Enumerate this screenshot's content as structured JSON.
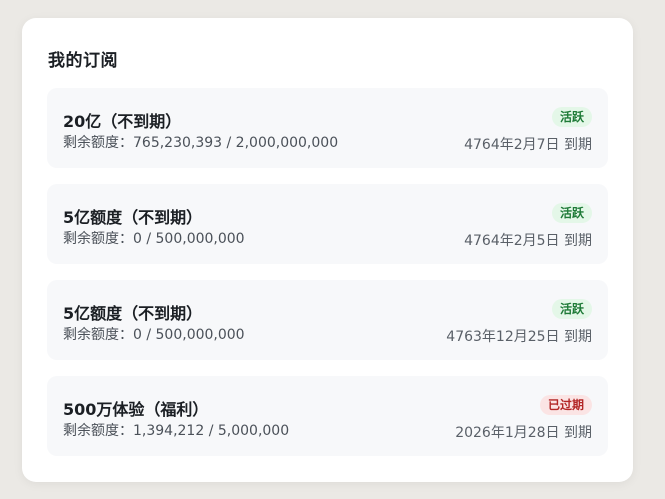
{
  "title": "我的订阅",
  "subscriptions": [
    {
      "name": "20亿（不到期）",
      "quota": "剩余额度：765,230,393 / 2,000,000,000",
      "status": "活跃",
      "status_type": "active",
      "expiry": "4764年2月7日 到期"
    },
    {
      "name": "5亿额度（不到期）",
      "quota": "剩余额度：0 / 500,000,000",
      "status": "活跃",
      "status_type": "active",
      "expiry": "4764年2月5日 到期"
    },
    {
      "name": "5亿额度（不到期）",
      "quota": "剩余额度：0 / 500,000,000",
      "status": "活跃",
      "status_type": "active",
      "expiry": "4763年12月25日 到期"
    },
    {
      "name": "500万体验（福利）",
      "quota": "剩余额度：1,394,212 / 5,000,000",
      "status": "已过期",
      "status_type": "expired",
      "expiry": "2026年1月28日 到期"
    }
  ],
  "colors": {
    "active_bg": "#e4f7e8",
    "active_text": "#1e7a37",
    "expired_bg": "#fbe4e4",
    "expired_text": "#b32727"
  }
}
